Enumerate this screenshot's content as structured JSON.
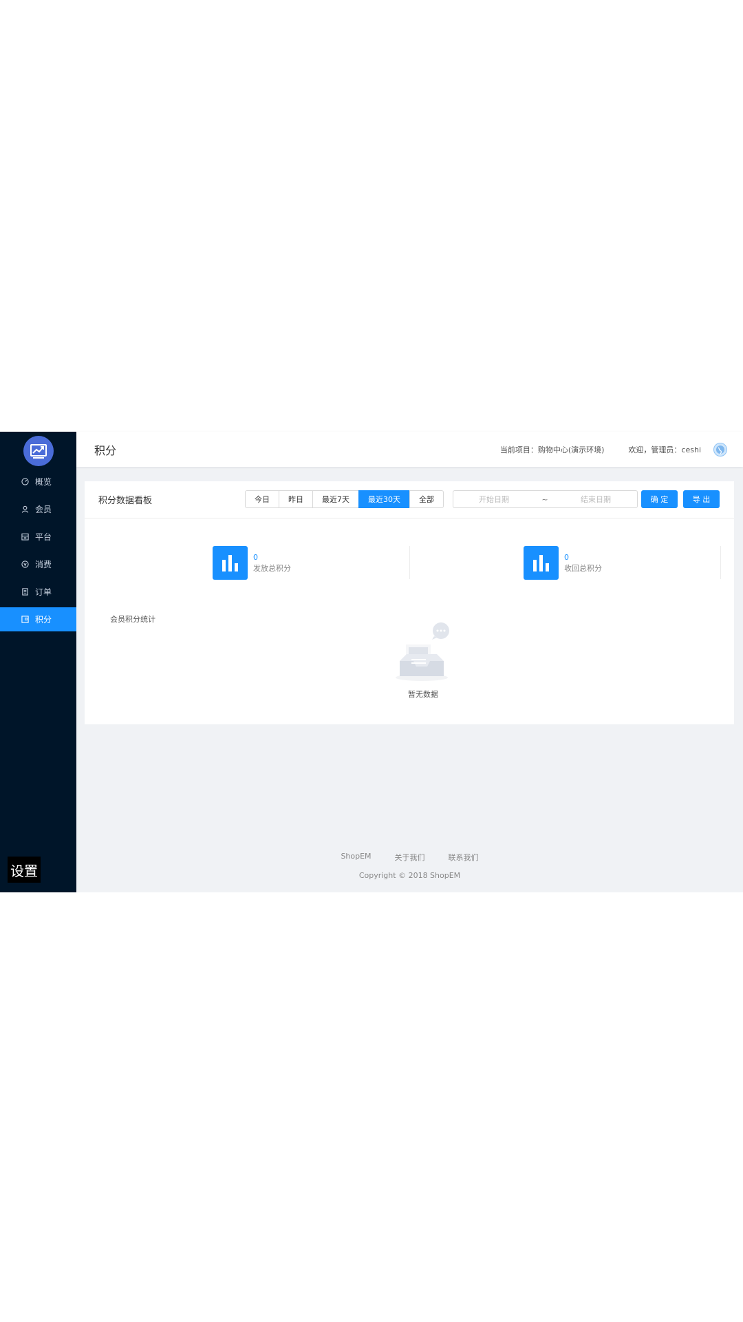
{
  "sidebar": {
    "items": [
      {
        "label": "概览",
        "icon": "dashboard-icon"
      },
      {
        "label": "会员",
        "icon": "user-icon"
      },
      {
        "label": "平台",
        "icon": "shop-icon"
      },
      {
        "label": "消费",
        "icon": "consume-icon"
      },
      {
        "label": "订单",
        "icon": "order-icon"
      },
      {
        "label": "积分",
        "icon": "points-icon",
        "active": true
      }
    ],
    "settings_label": "设置"
  },
  "header": {
    "title": "积分",
    "project": "当前项目：购物中心(演示环境)",
    "welcome": "欢迎，管理员：ceshi"
  },
  "panel": {
    "title": "积分数据看板",
    "tabs": [
      "今日",
      "昨日",
      "最近7天",
      "最近30天",
      "全部"
    ],
    "active_tab": "最近30天",
    "date_start_placeholder": "开始日期",
    "date_separator": "~",
    "date_end_placeholder": "结束日期",
    "confirm_label": "确 定",
    "export_label": "导 出"
  },
  "stats": [
    {
      "value": "0",
      "label": "发放总积分"
    },
    {
      "value": "0",
      "label": "收回总积分"
    }
  ],
  "chart_section": {
    "title": "会员积分统计",
    "empty_text": "暂无数据"
  },
  "footer": {
    "links": [
      "ShopEM",
      "关于我们",
      "联系我们"
    ],
    "copyright": "Copyright © 2018 ShopEM"
  },
  "colors": {
    "sidebar_bg": "#001529",
    "accent": "#1890ff",
    "page_bg": "#f0f2f5"
  }
}
